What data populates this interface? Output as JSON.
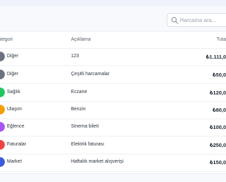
{
  "search": {
    "placeholder": "Harcama ara..."
  },
  "table": {
    "headers": {
      "category": "ategori",
      "description": "Açıklama",
      "total": "Tuta"
    },
    "rows": [
      {
        "category": "Diğer",
        "description": "123",
        "amount": "₺1.111,0",
        "color": "#6b7280"
      },
      {
        "category": "Diğer",
        "description": "Çeşitli harcamalar",
        "amount": "₺50,0",
        "color": "#6b7280"
      },
      {
        "category": "Sağlık",
        "description": "Eczane",
        "amount": "₺120,0",
        "color": "#22c55e"
      },
      {
        "category": "Ulaşım",
        "description": "Benzin",
        "amount": "₺80,0",
        "color": "#f59e0b"
      },
      {
        "category": "Eğlence",
        "description": "Sinema bileti",
        "amount": "₺100,0",
        "color": "#a855f7"
      },
      {
        "category": "Faturalar",
        "description": "Elektrik faturası",
        "amount": "₺250,0",
        "color": "#ef4444"
      },
      {
        "category": "Market",
        "description": "Haftalık market alışverişi",
        "amount": "₺150,0",
        "color": "#3b5bdb"
      }
    ]
  }
}
